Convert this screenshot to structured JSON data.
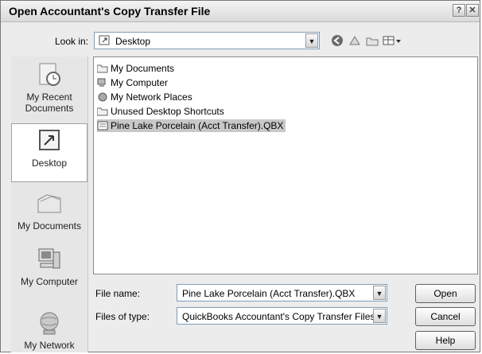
{
  "window": {
    "title": "Open Accountant's Copy Transfer File",
    "help_glyph": "?",
    "close_glyph": "✕"
  },
  "lookin": {
    "label": "Look in:",
    "value": "Desktop"
  },
  "places": [
    {
      "label": "My Recent Documents",
      "icon": "recent-documents-icon"
    },
    {
      "label": "Desktop",
      "icon": "desktop-icon",
      "selected": true
    },
    {
      "label": "My Documents",
      "icon": "my-documents-icon"
    },
    {
      "label": "My Computer",
      "icon": "my-computer-icon"
    },
    {
      "label": "My Network",
      "icon": "my-network-icon"
    }
  ],
  "files": [
    {
      "name": "My Documents",
      "icon": "folder-icon"
    },
    {
      "name": "My Computer",
      "icon": "computer-icon"
    },
    {
      "name": "My Network Places",
      "icon": "network-icon"
    },
    {
      "name": "Unused Desktop Shortcuts",
      "icon": "folder-icon"
    },
    {
      "name": "Pine Lake Porcelain (Acct Transfer).QBX",
      "icon": "qbx-file-icon",
      "selected": true
    }
  ],
  "filename": {
    "label": "File name:",
    "value": "Pine Lake Porcelain (Acct Transfer).QBX"
  },
  "filetype": {
    "label": "Files of type:",
    "value": "QuickBooks Accountant's Copy Transfer Files ("
  },
  "buttons": {
    "open": "Open",
    "cancel": "Cancel",
    "help": "Help"
  }
}
